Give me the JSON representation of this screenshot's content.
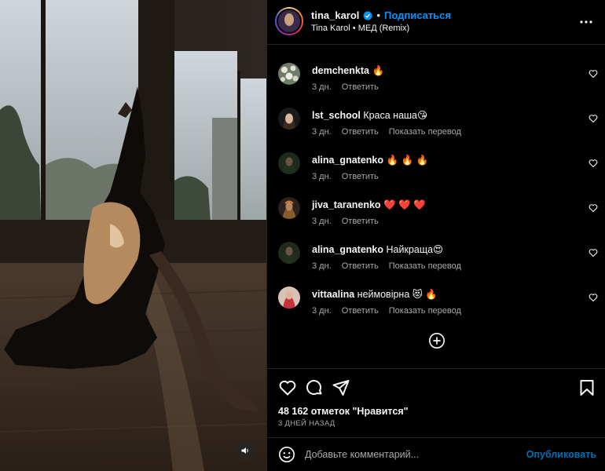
{
  "header": {
    "username": "tina_karol",
    "separator": "•",
    "follow_label": "Подписаться",
    "audio_info": "Tina Karol • МЕД (Remix)",
    "verified_color": "#0095f6"
  },
  "comments": [
    {
      "user": "demchenkta",
      "text": "🔥",
      "age": "3 дн.",
      "actions": [
        "Ответить"
      ],
      "avatar": "flower-pattern"
    },
    {
      "user": "lst_school",
      "text": "Краса наша😘",
      "age": "3 дн.",
      "actions": [
        "Ответить",
        "Показать перевод"
      ],
      "avatar": "portrait-dark-hair"
    },
    {
      "user": "alina_gnatenko",
      "text": "🔥 🔥 🔥",
      "age": "3 дн.",
      "actions": [
        "Ответить"
      ],
      "avatar": "portrait-dark"
    },
    {
      "user": "jiva_taranenko",
      "text": "❤️ ❤️ ❤️",
      "age": "3 дн.",
      "actions": [
        "Ответить"
      ],
      "avatar": "portrait-colorful"
    },
    {
      "user": "alina_gnatenko",
      "text": "Найкраща😍",
      "age": "3 дн.",
      "actions": [
        "Ответить",
        "Показать перевод"
      ],
      "avatar": "portrait-dark"
    },
    {
      "user": "vittaalina",
      "text": "неймовірна 😻 🔥",
      "age": "3 дн.",
      "actions": [
        "Ответить",
        "Показать перевод"
      ],
      "avatar": "portrait-pink"
    }
  ],
  "actions": {
    "likes": "48 162 отметок \"Нравится\"",
    "time": "3 ДНЕЙ НАЗАД"
  },
  "compose": {
    "placeholder": "Добавьте комментарий...",
    "publish_label": "Опубликовать"
  },
  "colors": {
    "accent": "#0095f6",
    "text": "#f5f5f5",
    "muted": "#a8a8a8",
    "border": "#262626",
    "background": "#000000"
  }
}
